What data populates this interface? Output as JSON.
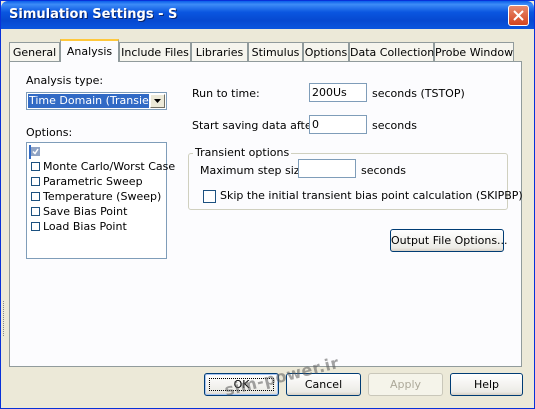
{
  "window": {
    "title": "Simulation Settings - S"
  },
  "tabs": [
    {
      "label": "General"
    },
    {
      "label": "Analysis"
    },
    {
      "label": "Include Files"
    },
    {
      "label": "Libraries"
    },
    {
      "label": "Stimulus"
    },
    {
      "label": "Options"
    },
    {
      "label": "Data Collection"
    },
    {
      "label": "Probe Window"
    }
  ],
  "analysis": {
    "type_label": "Analysis type:",
    "type_value": "Time Domain (Transient)",
    "options_label": "Options:",
    "options": [
      {
        "label": "General Settings",
        "checked": true,
        "selected": true
      },
      {
        "label": "Monte Carlo/Worst Case",
        "checked": false,
        "selected": false
      },
      {
        "label": "Parametric Sweep",
        "checked": false,
        "selected": false
      },
      {
        "label": "Temperature (Sweep)",
        "checked": false,
        "selected": false
      },
      {
        "label": "Save Bias Point",
        "checked": false,
        "selected": false
      },
      {
        "label": "Load Bias Point",
        "checked": false,
        "selected": false
      }
    ],
    "run_to_time_label": "Run to time:",
    "run_to_time_value": "200Us",
    "run_to_time_unit": "seconds  (TSTOP)",
    "start_saving_label": "Start saving data after:",
    "start_saving_value": "0",
    "start_saving_unit": "seconds",
    "transient_group_label": "Transient options",
    "max_step_label": "Maximum step size:",
    "max_step_value": "",
    "max_step_unit": "seconds",
    "skip_bias_label": "Skip the initial transient bias point calculation  (SKIPBP)",
    "skip_bias_checked": false,
    "output_file_options_label": "Output File Options..."
  },
  "buttons": {
    "ok": "OK",
    "cancel": "Cancel",
    "apply": "Apply",
    "help": "Help"
  },
  "watermark": "sim-power.ir",
  "colors": {
    "titlebar": "#0A56E0",
    "selection": "#316AC5",
    "tab_highlight": "#FFC83C",
    "dialog_bg": "#ECE9D8"
  }
}
